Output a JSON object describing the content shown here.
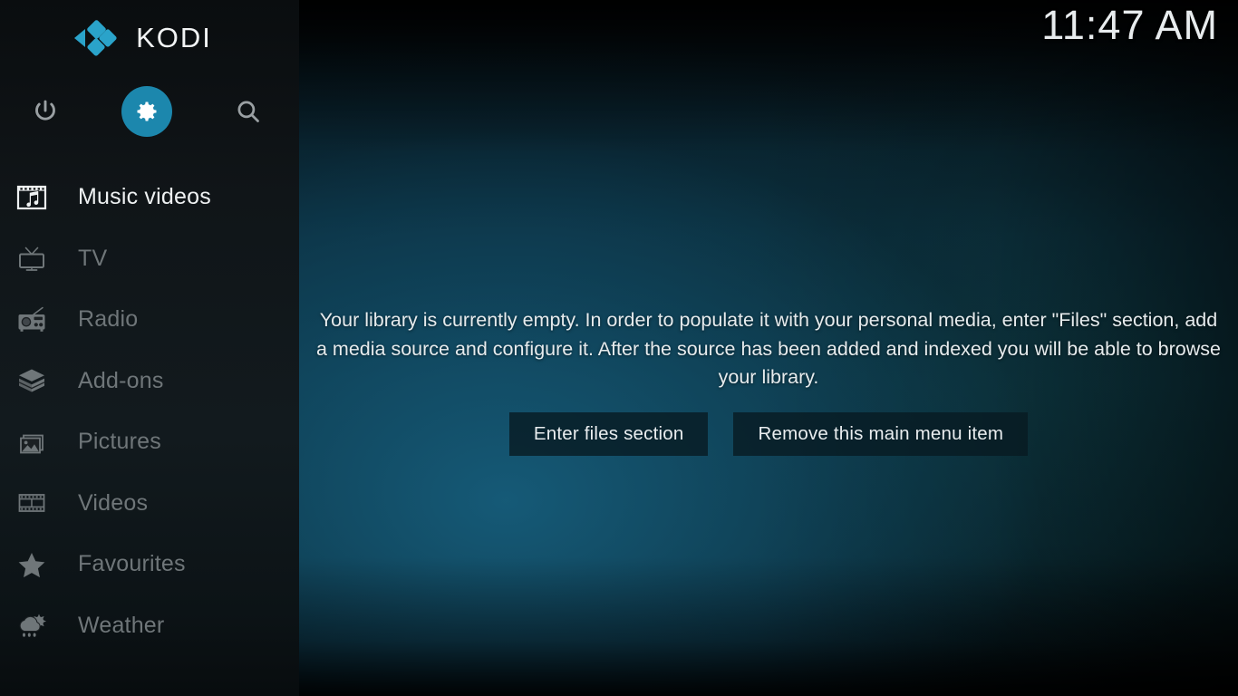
{
  "app": {
    "name": "KODI",
    "logo_color": "#2aa3ca",
    "accent_color": "#1c87ad"
  },
  "header": {
    "clock": "11:47 AM"
  },
  "sidebar": {
    "quick_actions": [
      {
        "name": "power-icon",
        "label": "Power"
      },
      {
        "name": "gear-icon",
        "label": "Settings"
      },
      {
        "name": "search-icon",
        "label": "Search"
      }
    ],
    "items": [
      {
        "label": "Music videos",
        "icon": "music-video-icon",
        "selected": true
      },
      {
        "label": "TV",
        "icon": "tv-icon",
        "selected": false
      },
      {
        "label": "Radio",
        "icon": "radio-icon",
        "selected": false
      },
      {
        "label": "Add-ons",
        "icon": "addons-box-icon",
        "selected": false
      },
      {
        "label": "Pictures",
        "icon": "picture-icon",
        "selected": false
      },
      {
        "label": "Videos",
        "icon": "filmstrip-icon",
        "selected": false
      },
      {
        "label": "Favourites",
        "icon": "star-icon",
        "selected": false
      },
      {
        "label": "Weather",
        "icon": "weather-icon",
        "selected": false
      }
    ]
  },
  "main": {
    "empty_message": "Your library is currently empty. In order to populate it with your personal media, enter \"Files\" section, add a media source and configure it. After the source has been added and indexed you will be able to browse your library.",
    "buttons": {
      "enter_files": "Enter files section",
      "remove_menu_item": "Remove this main menu item"
    }
  }
}
